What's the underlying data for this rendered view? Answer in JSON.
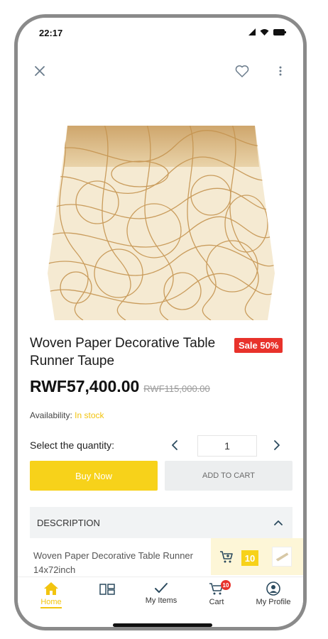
{
  "status_bar": {
    "time": "22:17"
  },
  "product": {
    "title": "Woven Paper Decorative Table Runner Taupe",
    "sale_badge": "Sale 50%",
    "price": "RWF57,400.00",
    "old_price": "RWF115,000.00",
    "availability_label": "Availability:",
    "availability_value": "In stock"
  },
  "quantity": {
    "label": "Select the quantity:",
    "value": "1"
  },
  "actions": {
    "buy_now": "Buy Now",
    "add_to_cart": "ADD TO CART"
  },
  "description": {
    "header": "DESCRIPTION",
    "text_line1": "Woven Paper Decorative Table Runner",
    "text_line2": "14x72inch"
  },
  "cart_float": {
    "count": "10"
  },
  "nav": {
    "items": [
      {
        "label": "Home",
        "icon": "home-icon"
      },
      {
        "label": "",
        "icon": "categories-icon"
      },
      {
        "label": "My Items",
        "icon": "check-icon"
      },
      {
        "label": "Cart",
        "icon": "cart-icon",
        "badge": "10"
      },
      {
        "label": "My Profile",
        "icon": "profile-icon"
      }
    ]
  },
  "colors": {
    "accent": "#f7d21a",
    "sale": "#e8322b",
    "stock": "#f2c40f"
  }
}
